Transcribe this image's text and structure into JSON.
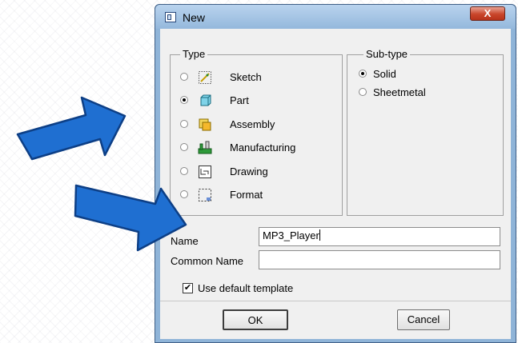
{
  "dialog": {
    "title": "New",
    "close_label": "X"
  },
  "type_group": {
    "label": "Type",
    "options": [
      {
        "label": "Sketch",
        "icon": "sketch-icon",
        "selected": false
      },
      {
        "label": "Part",
        "icon": "part-icon",
        "selected": true
      },
      {
        "label": "Assembly",
        "icon": "assembly-icon",
        "selected": false
      },
      {
        "label": "Manufacturing",
        "icon": "manufacturing-icon",
        "selected": false
      },
      {
        "label": "Drawing",
        "icon": "drawing-icon",
        "selected": false
      },
      {
        "label": "Format",
        "icon": "format-icon",
        "selected": false
      }
    ]
  },
  "subtype_group": {
    "label": "Sub-type",
    "options": [
      {
        "label": "Solid",
        "selected": true
      },
      {
        "label": "Sheetmetal",
        "selected": false
      }
    ]
  },
  "name_field": {
    "label": "Name",
    "value": "MP3_Player"
  },
  "common_name_field": {
    "label": "Common Name",
    "value": ""
  },
  "template_checkbox": {
    "label": "Use default template",
    "checked": true
  },
  "buttons": {
    "ok": "OK",
    "cancel": "Cancel"
  },
  "colors": {
    "arrow": "#1f6fd1",
    "arrow_border": "#0d3f86",
    "title_bar": "#9dbfe2"
  }
}
